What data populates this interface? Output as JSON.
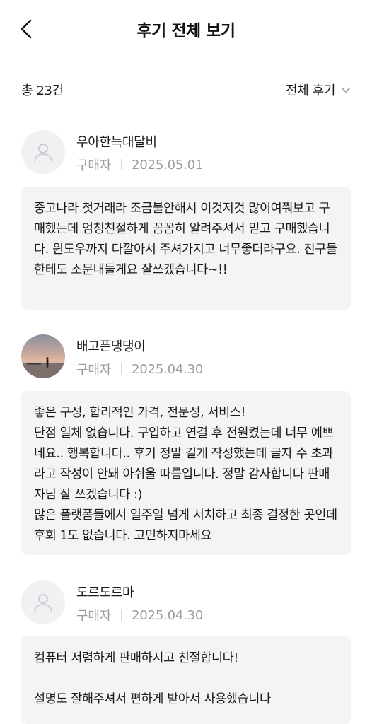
{
  "header": {
    "title": "후기 전체 보기"
  },
  "summary": {
    "total_label": "총 23건",
    "filter_label": "전체 후기"
  },
  "reviews": [
    {
      "name": "우아한늑대달비",
      "role": "구매자",
      "date": "2025.05.01",
      "text": "중고나라 첫거래라 조금불안해서 이것저것 많이여쭤보고 구매했는데 엄청친절하게 꼼꼼히 알려주셔서 믿고 구매했습니다. 윈도우까지 다깔아서 주셔가지고 너무좋더라구요. 친구들한테도 소문내둘게요 잘쓰겠습니다~!!"
    },
    {
      "name": "배고픈댕댕이",
      "role": "구매자",
      "date": "2025.04.30",
      "text": "좋은 구성, 합리적인 가격, 전문성, 서비스!\n단점 일체 없습니다. 구입하고 연결 후 전원켰는데 너무 예쁘네요.. 행복합니다.. 후기 정말 길게 작성했는데 글자 수 초과라고 작성이 안돼 아쉬울 따름입니다. 정말 감사합니다 판매자님 잘 쓰겠습니다 :)\n많은 플랫폼들에서 일주일 넘게 서치하고 최종 결정한 곳인데 후회 1도 없습니다. 고민하지마세요"
    },
    {
      "name": "도르도르마",
      "role": "구매자",
      "date": "2025.04.30",
      "text": "컴퓨터 저렴하게 판매하시고 친절합니다!\n\n설명도 잘해주셔서 편하게 받아서 사용했습니다"
    }
  ]
}
